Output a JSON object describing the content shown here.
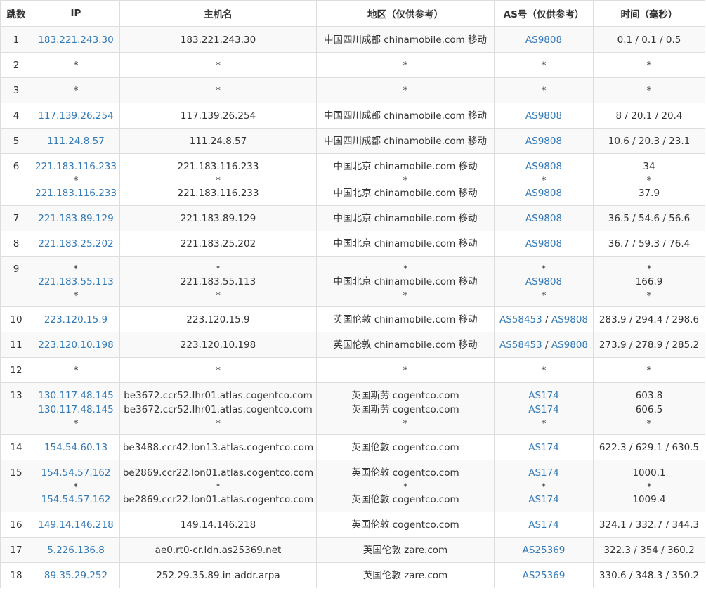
{
  "columns": [
    "跳数",
    "IP",
    "主机名",
    "地区（仅供参考）",
    "AS号（仅供参考）",
    "时间（毫秒）"
  ],
  "rows": [
    {
      "hop": "1",
      "lines": [
        {
          "ip": "183.221.243.30",
          "host": "183.221.243.30",
          "region": "中国四川成都 chinamobile.com 移动",
          "as": [
            "AS9808"
          ],
          "time": "0.1 / 0.1 / 0.5"
        }
      ]
    },
    {
      "hop": "2",
      "lines": [
        {
          "ip": "*",
          "host": "*",
          "region": "*",
          "as": [
            "*"
          ],
          "time": "*"
        }
      ]
    },
    {
      "hop": "3",
      "lines": [
        {
          "ip": "*",
          "host": "*",
          "region": "*",
          "as": [
            "*"
          ],
          "time": "*"
        }
      ]
    },
    {
      "hop": "4",
      "lines": [
        {
          "ip": "117.139.26.254",
          "host": "117.139.26.254",
          "region": "中国四川成都 chinamobile.com 移动",
          "as": [
            "AS9808"
          ],
          "time": "8 / 20.1 / 20.4"
        }
      ]
    },
    {
      "hop": "5",
      "lines": [
        {
          "ip": "111.24.8.57",
          "host": "111.24.8.57",
          "region": "中国四川成都 chinamobile.com 移动",
          "as": [
            "AS9808"
          ],
          "time": "10.6 / 20.3 / 23.1"
        }
      ]
    },
    {
      "hop": "6",
      "lines": [
        {
          "ip": "221.183.116.233",
          "host": "221.183.116.233",
          "region": "中国北京 chinamobile.com 移动",
          "as": [
            "AS9808"
          ],
          "time": "34"
        },
        {
          "ip": "*",
          "host": "*",
          "region": "*",
          "as": [
            "*"
          ],
          "time": "*"
        },
        {
          "ip": "221.183.116.233",
          "host": "221.183.116.233",
          "region": "中国北京 chinamobile.com 移动",
          "as": [
            "AS9808"
          ],
          "time": "37.9"
        }
      ]
    },
    {
      "hop": "7",
      "lines": [
        {
          "ip": "221.183.89.129",
          "host": "221.183.89.129",
          "region": "中国北京 chinamobile.com 移动",
          "as": [
            "AS9808"
          ],
          "time": "36.5 / 54.6 / 56.6"
        }
      ]
    },
    {
      "hop": "8",
      "lines": [
        {
          "ip": "221.183.25.202",
          "host": "221.183.25.202",
          "region": "中国北京 chinamobile.com 移动",
          "as": [
            "AS9808"
          ],
          "time": "36.7 / 59.3 / 76.4"
        }
      ]
    },
    {
      "hop": "9",
      "lines": [
        {
          "ip": "*",
          "host": "*",
          "region": "*",
          "as": [
            "*"
          ],
          "time": "*"
        },
        {
          "ip": "221.183.55.113",
          "host": "221.183.55.113",
          "region": "中国北京 chinamobile.com 移动",
          "as": [
            "AS9808"
          ],
          "time": "166.9"
        },
        {
          "ip": "*",
          "host": "*",
          "region": "*",
          "as": [
            "*"
          ],
          "time": "*"
        }
      ]
    },
    {
      "hop": "10",
      "lines": [
        {
          "ip": "223.120.15.9",
          "host": "223.120.15.9",
          "region": "英国伦敦 chinamobile.com 移动",
          "as": [
            "AS58453",
            "AS9808"
          ],
          "time": "283.9 / 294.4 / 298.6"
        }
      ]
    },
    {
      "hop": "11",
      "lines": [
        {
          "ip": "223.120.10.198",
          "host": "223.120.10.198",
          "region": "英国伦敦 chinamobile.com 移动",
          "as": [
            "AS58453",
            "AS9808"
          ],
          "time": "273.9 / 278.9 / 285.2"
        }
      ]
    },
    {
      "hop": "12",
      "lines": [
        {
          "ip": "*",
          "host": "*",
          "region": "*",
          "as": [
            "*"
          ],
          "time": "*"
        }
      ]
    },
    {
      "hop": "13",
      "lines": [
        {
          "ip": "130.117.48.145",
          "host": "be3672.ccr52.lhr01.atlas.cogentco.com",
          "region": "英国斯劳 cogentco.com",
          "as": [
            "AS174"
          ],
          "time": "603.8"
        },
        {
          "ip": "130.117.48.145",
          "host": "be3672.ccr52.lhr01.atlas.cogentco.com",
          "region": "英国斯劳 cogentco.com",
          "as": [
            "AS174"
          ],
          "time": "606.5"
        },
        {
          "ip": "*",
          "host": "*",
          "region": "*",
          "as": [
            "*"
          ],
          "time": "*"
        }
      ]
    },
    {
      "hop": "14",
      "lines": [
        {
          "ip": "154.54.60.13",
          "host": "be3488.ccr42.lon13.atlas.cogentco.com",
          "region": "英国伦敦 cogentco.com",
          "as": [
            "AS174"
          ],
          "time": "622.3 / 629.1 / 630.5"
        }
      ]
    },
    {
      "hop": "15",
      "lines": [
        {
          "ip": "154.54.57.162",
          "host": "be2869.ccr22.lon01.atlas.cogentco.com",
          "region": "英国伦敦 cogentco.com",
          "as": [
            "AS174"
          ],
          "time": "1000.1"
        },
        {
          "ip": "*",
          "host": "*",
          "region": "*",
          "as": [
            "*"
          ],
          "time": "*"
        },
        {
          "ip": "154.54.57.162",
          "host": "be2869.ccr22.lon01.atlas.cogentco.com",
          "region": "英国伦敦 cogentco.com",
          "as": [
            "AS174"
          ],
          "time": "1009.4"
        }
      ]
    },
    {
      "hop": "16",
      "lines": [
        {
          "ip": "149.14.146.218",
          "host": "149.14.146.218",
          "region": "英国伦敦 cogentco.com",
          "as": [
            "AS174"
          ],
          "time": "324.1 / 332.7 / 344.3"
        }
      ]
    },
    {
      "hop": "17",
      "lines": [
        {
          "ip": "5.226.136.8",
          "host": "ae0.rt0-cr.ldn.as25369.net",
          "region": "英国伦敦 zare.com",
          "as": [
            "AS25369"
          ],
          "time": "322.3 / 354 / 360.2"
        }
      ]
    },
    {
      "hop": "18",
      "lines": [
        {
          "ip": "89.35.29.252",
          "host": "252.29.35.89.in-addr.arpa",
          "region": "英国伦敦 zare.com",
          "as": [
            "AS25369"
          ],
          "time": "330.6 / 348.3 / 350.2"
        }
      ]
    }
  ],
  "colors": {
    "link": "#337ab7",
    "text": "#333333",
    "border": "#dddddd",
    "stripe": "#f9f9f9"
  }
}
